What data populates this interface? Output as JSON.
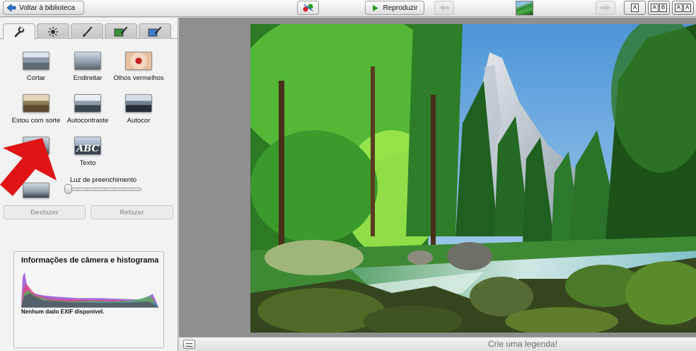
{
  "toolbar": {
    "back_label": "Voltar à biblioteca",
    "play_label": "Reproduzir",
    "text_sizes": [
      [
        "A"
      ],
      [
        "A",
        "B"
      ],
      [
        "A",
        "A"
      ]
    ]
  },
  "tabs": [
    {
      "icon": "wrench-icon",
      "active": true
    },
    {
      "icon": "sun-icon",
      "active": false
    },
    {
      "icon": "brush-icon",
      "active": false
    },
    {
      "icon": "effect-brush-icon",
      "active": false
    },
    {
      "icon": "effect-brush-blue-icon",
      "active": false
    }
  ],
  "tools": {
    "crop": "Cortar",
    "straighten": "Endireitar",
    "redeye": "Olhos vermelhos",
    "lucky": "Estou com sorte",
    "autocontrast": "Autocontraste",
    "autocolor": "Autocor",
    "text": "Texto",
    "text_icon": "ABC"
  },
  "fill_light": {
    "label": "Luz de preenchimento",
    "value": 0
  },
  "actions": {
    "undo": "Desfazer",
    "redo": "Refazer"
  },
  "exif": {
    "title": "Informações de câmera e histograma",
    "note": "Nenhum dado EXIF disponível."
  },
  "caption": {
    "placeholder": "Crie uma legenda!"
  },
  "colors": {
    "annotation_arrow": "#e01414",
    "accent_blue": "#2b6fc9",
    "play_green": "#2a9a2a"
  }
}
